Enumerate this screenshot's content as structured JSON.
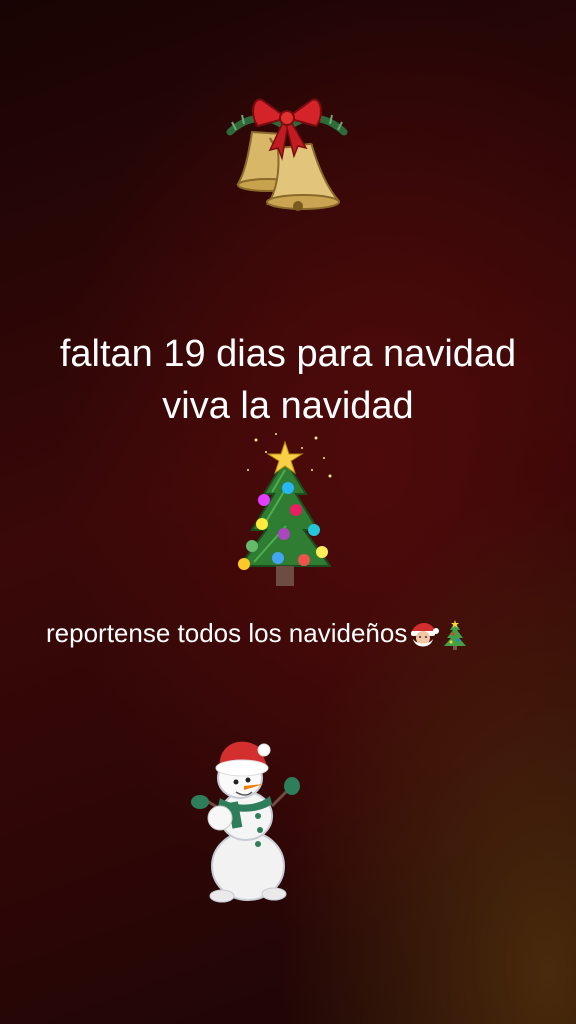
{
  "story": {
    "line1": "faltan 19 dias para navidad",
    "line2": "viva la navidad",
    "caption": "reportense todos los navideños",
    "caption_emojis": [
      "santa-emoji",
      "christmas-tree-emoji"
    ]
  },
  "stickers": [
    "christmas-bells-sticker",
    "christmas-tree-sticker",
    "snowman-sticker"
  ],
  "colors": {
    "background": "#2c0606",
    "text": "#ffffff"
  }
}
